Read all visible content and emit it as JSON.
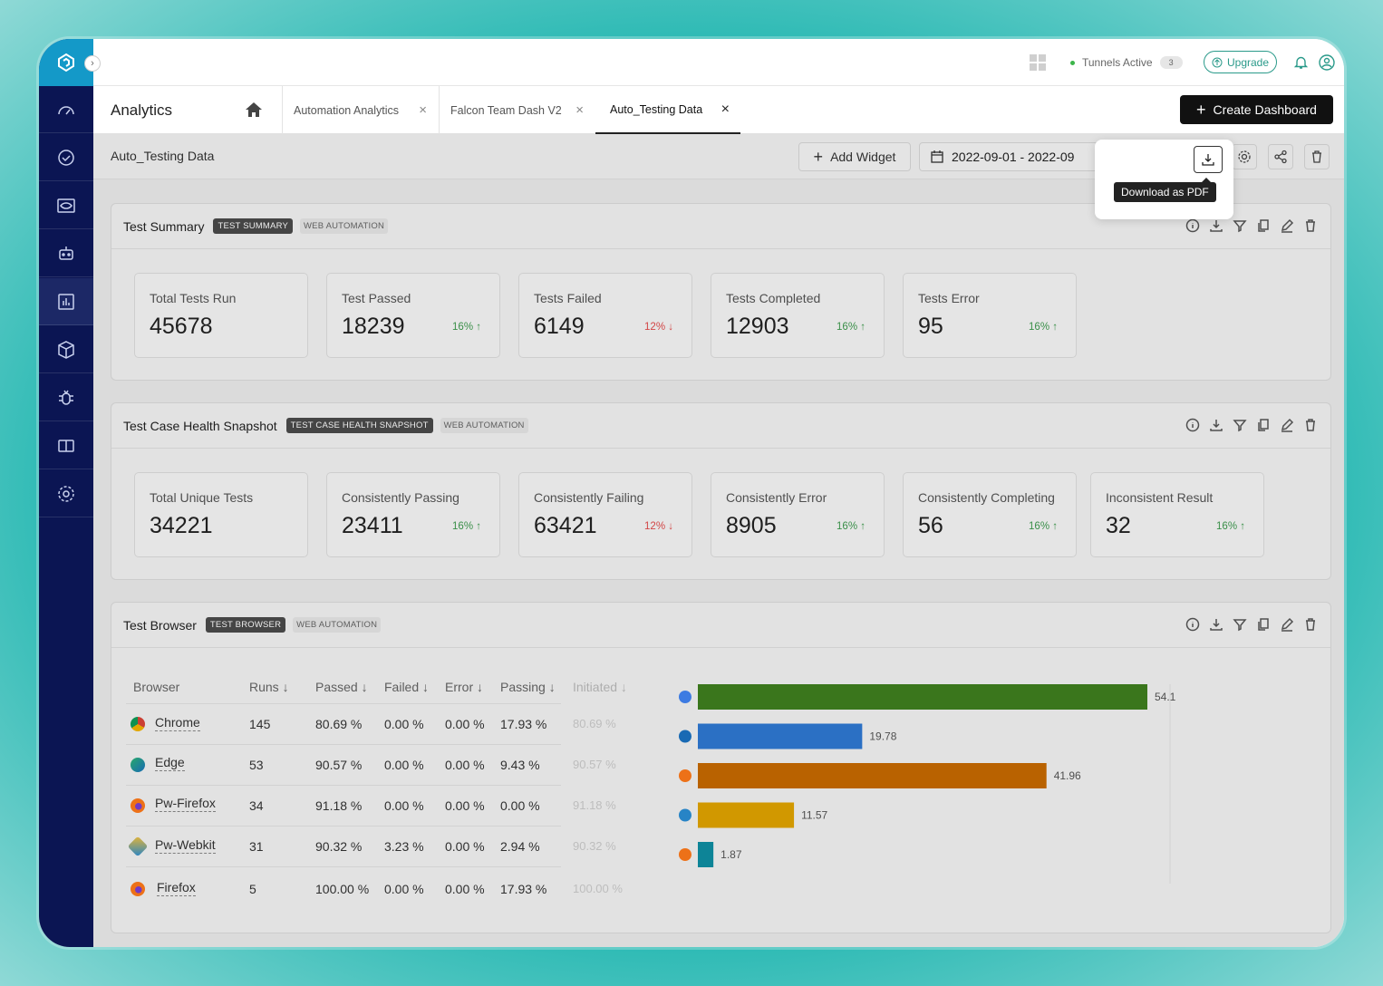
{
  "topbar": {
    "tunnels_label": "Tunnels Active",
    "tunnels_count": "3",
    "upgrade_label": "Upgrade"
  },
  "tabs": {
    "home_label": "Analytics",
    "items": [
      {
        "label": "Automation Analytics",
        "active": false
      },
      {
        "label": "Falcon Team Dash V2",
        "active": false
      },
      {
        "label": "Auto_Testing Data",
        "active": true
      }
    ],
    "create_label": "Create Dashboard"
  },
  "toolbar": {
    "dashboard_name": "Auto_Testing Data",
    "add_widget_label": "Add Widget",
    "date_range": "2022-09-01 - 2022-09",
    "tooltip": "Download as PDF"
  },
  "test_summary": {
    "title": "Test Summary",
    "tag": "TEST SUMMARY",
    "category": "WEB AUTOMATION",
    "metrics": [
      {
        "label": "Total Tests Run",
        "value": "45678",
        "trend": ""
      },
      {
        "label": "Test Passed",
        "value": "18239",
        "trend": "16% ↑"
      },
      {
        "label": "Tests Failed",
        "value": "6149",
        "trend": "12% ↓"
      },
      {
        "label": "Tests Completed",
        "value": "12903",
        "trend": "16% ↑"
      },
      {
        "label": "Tests Error",
        "value": "95",
        "trend": "16% ↑"
      }
    ]
  },
  "health": {
    "title": "Test Case Health Snapshot",
    "tag": "TEST CASE HEALTH SNAPSHOT",
    "category": "WEB AUTOMATION",
    "metrics": [
      {
        "label": "Total Unique Tests",
        "value": "34221",
        "trend": ""
      },
      {
        "label": "Consistently Passing",
        "value": "23411",
        "trend": "16% ↑"
      },
      {
        "label": "Consistently Failing",
        "value": "63421",
        "trend": "12% ↓"
      },
      {
        "label": "Consistently Error",
        "value": "8905",
        "trend": "16% ↑"
      },
      {
        "label": "Consistently Completing",
        "value": "56",
        "trend": "16% ↑"
      },
      {
        "label": "Inconsistent Result",
        "value": "32",
        "trend": "16% ↑"
      }
    ]
  },
  "browser": {
    "title": "Test Browser",
    "tag": "TEST BROWSER",
    "category": "WEB AUTOMATION",
    "headers": [
      "Browser",
      "Runs ↓",
      "Passed ↓",
      "Failed ↓",
      "Error ↓",
      "Passing ↓",
      "Initiated ↓"
    ],
    "rows": [
      {
        "name": "Chrome",
        "runs": "145",
        "passed": "80.69 %",
        "failed": "0.00 %",
        "error": "0.00 %",
        "passing": "17.93 %",
        "initiated": "80.69 %"
      },
      {
        "name": "Edge",
        "runs": "53",
        "passed": "90.57 %",
        "failed": "0.00 %",
        "error": "0.00 %",
        "passing": "9.43 %",
        "initiated": "90.57 %"
      },
      {
        "name": "Pw-Firefox",
        "runs": "34",
        "passed": "91.18 %",
        "failed": "0.00 %",
        "error": "0.00 %",
        "passing": "0.00 %",
        "initiated": "91.18 %"
      },
      {
        "name": "Pw-Webkit",
        "runs": "31",
        "passed": "90.32 %",
        "failed": "3.23 %",
        "error": "0.00 %",
        "passing": "2.94 %",
        "initiated": "90.32 %"
      },
      {
        "name": "Firefox",
        "runs": "5",
        "passed": "100.00 %",
        "failed": "0.00 %",
        "error": "0.00 %",
        "passing": "17.93 %",
        "initiated": "100.00 %"
      }
    ]
  },
  "chart_data": {
    "type": "bar",
    "orientation": "horizontal",
    "categories": [
      "Chrome",
      "Edge",
      "Pw-Firefox",
      "Pw-Webkit",
      "Firefox"
    ],
    "values": [
      54.1,
      19.78,
      41.96,
      11.57,
      1.87
    ],
    "value_labels": [
      "54.1",
      "19.78",
      "41.96",
      "11.57",
      "1.87"
    ],
    "colors": [
      "#3f7f1f",
      "#2f79d3",
      "#c86a00",
      "#e1a400",
      "#0f8fa3"
    ]
  }
}
